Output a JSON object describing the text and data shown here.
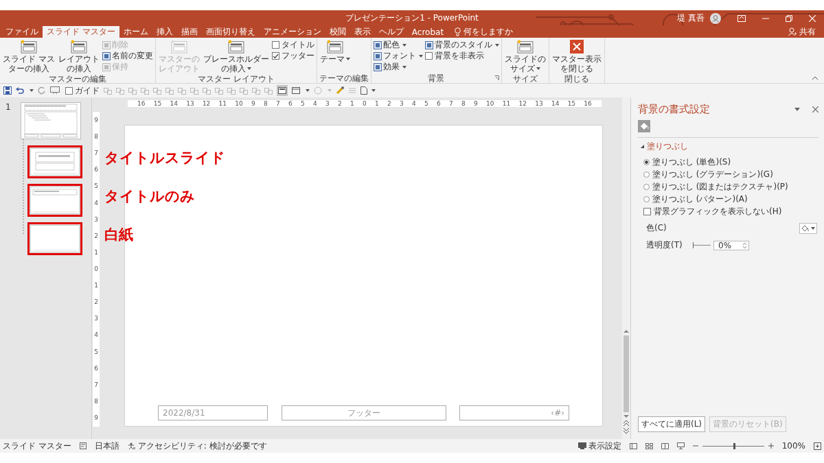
{
  "window": {
    "title": "プレゼンテーション1 - PowerPoint",
    "user": "堤 真吾",
    "share": "共有"
  },
  "tabs": [
    {
      "label": "ファイル",
      "selected": false
    },
    {
      "label": "スライド マスター",
      "selected": true
    },
    {
      "label": "ホーム",
      "selected": false
    },
    {
      "label": "挿入",
      "selected": false
    },
    {
      "label": "描画",
      "selected": false
    },
    {
      "label": "画面切り替え",
      "selected": false
    },
    {
      "label": "アニメーション",
      "selected": false
    },
    {
      "label": "校閲",
      "selected": false
    },
    {
      "label": "表示",
      "selected": false
    },
    {
      "label": "ヘルプ",
      "selected": false
    },
    {
      "label": "Acrobat",
      "selected": false
    }
  ],
  "tell_me": "何をしますか",
  "ribbon_groups": [
    {
      "label": "マスターの編集",
      "items": [
        {
          "kind": "large",
          "label_lines": [
            "スライド マス",
            "ターの挿入"
          ],
          "disabled": false,
          "dropdown": false
        },
        {
          "kind": "large",
          "label_lines": [
            "レイアウト",
            "の挿入"
          ],
          "disabled": false,
          "dropdown": false
        },
        {
          "kind": "column",
          "items": [
            {
              "kind": "small",
              "label": "削除",
              "disabled": true,
              "dropdown": false
            },
            {
              "kind": "small",
              "label": "名前の変更",
              "disabled": false,
              "dropdown": false
            },
            {
              "kind": "small",
              "label": "保持",
              "disabled": true,
              "dropdown": false
            }
          ]
        }
      ]
    },
    {
      "label": "マスター レイアウト",
      "items": [
        {
          "kind": "large",
          "label_lines": [
            "マスターの",
            "レイアウト"
          ],
          "disabled": true,
          "dropdown": false
        },
        {
          "kind": "large",
          "label_lines": [
            "プレースホルダー",
            "の挿入"
          ],
          "disabled": false,
          "dropdown": true
        },
        {
          "kind": "column",
          "items": [
            {
              "kind": "checkbox",
              "label": "タイトル",
              "checked": false
            },
            {
              "kind": "checkbox",
              "label": "フッター",
              "checked": true
            }
          ]
        }
      ]
    },
    {
      "label": "テーマの編集",
      "items": [
        {
          "kind": "large",
          "label_lines": [
            "テーマ"
          ],
          "disabled": false,
          "dropdown": true
        }
      ]
    },
    {
      "label": "背景",
      "launcher": true,
      "items": [
        {
          "kind": "column",
          "items": [
            {
              "kind": "small",
              "label": "配色",
              "disabled": false,
              "dropdown": true
            },
            {
              "kind": "small",
              "label": "フォント",
              "disabled": false,
              "dropdown": true
            },
            {
              "kind": "small",
              "label": "効果",
              "disabled": false,
              "dropdown": true
            }
          ]
        },
        {
          "kind": "column",
          "items": [
            {
              "kind": "small",
              "label": "背景のスタイル",
              "disabled": false,
              "dropdown": true
            },
            {
              "kind": "checkbox",
              "label": "背景を非表示",
              "checked": false
            }
          ]
        }
      ]
    },
    {
      "label": "サイズ",
      "items": [
        {
          "kind": "large",
          "label_lines": [
            "スライドの",
            "サイズ"
          ],
          "disabled": false,
          "dropdown": true
        }
      ]
    },
    {
      "label": "閉じる",
      "items": [
        {
          "kind": "close",
          "label_lines": [
            "マスター表示",
            "を閉じる"
          ],
          "disabled": false,
          "dropdown": false
        }
      ]
    }
  ],
  "quick_access": {
    "guide": {
      "label": "ガイド",
      "checked": false
    }
  },
  "thumbnails": {
    "master_number": "1",
    "layouts": [
      {
        "kind": "title-slide",
        "callout": "タイトルスライド"
      },
      {
        "kind": "title-only",
        "callout": "タイトルのみ"
      },
      {
        "kind": "blank",
        "callout": "白紙"
      }
    ]
  },
  "horizontal_ruler": [
    "16",
    "15",
    "14",
    "13",
    "12",
    "11",
    "10",
    "9",
    "8",
    "7",
    "6",
    "5",
    "4",
    "3",
    "2",
    "1",
    "0",
    "1",
    "2",
    "3",
    "4",
    "5",
    "6",
    "7",
    "8",
    "9",
    "10",
    "11",
    "12",
    "13",
    "14",
    "15",
    "16"
  ],
  "vertical_ruler": [
    "9",
    "8",
    "7",
    "6",
    "5",
    "4",
    "3",
    "2",
    "1",
    "0",
    "1",
    "2",
    "3",
    "4",
    "5",
    "6",
    "7",
    "8",
    "9"
  ],
  "slide": {
    "placeholders": [
      {
        "kind": "date",
        "text": "2022/8/31"
      },
      {
        "kind": "footer",
        "text": "フッター"
      },
      {
        "kind": "number",
        "text": "‹#›"
      }
    ]
  },
  "format_pane": {
    "title": "背景の書式設定",
    "section": {
      "label": "塗りつぶし",
      "expanded": true
    },
    "fill_options": [
      {
        "label": "塗りつぶし (単色)(S)",
        "selected": true
      },
      {
        "label": "塗りつぶし (グラデーション)(G)",
        "selected": false
      },
      {
        "label": "塗りつぶし (図またはテクスチャ)(P)",
        "selected": false
      },
      {
        "label": "塗りつぶし (パターン)(A)",
        "selected": false
      }
    ],
    "hide_graphics": {
      "label": "背景グラフィックを表示しない(H)",
      "checked": false
    },
    "color_label": "色(C)",
    "transparency_label": "透明度(T)",
    "transparency": {
      "level": 0,
      "value": "0%"
    },
    "buttons": [
      {
        "label": "すべてに適用(L)",
        "disabled": false
      },
      {
        "label": "背景のリセット(B)",
        "disabled": true
      }
    ]
  },
  "status_bar": {
    "mode": "スライド マスター",
    "language": "日本語",
    "accessibility": "アクセシビリティ: 検討が必要です",
    "display_settings": "表示設定",
    "zoom": {
      "level": 0.5,
      "value": "100%"
    }
  }
}
